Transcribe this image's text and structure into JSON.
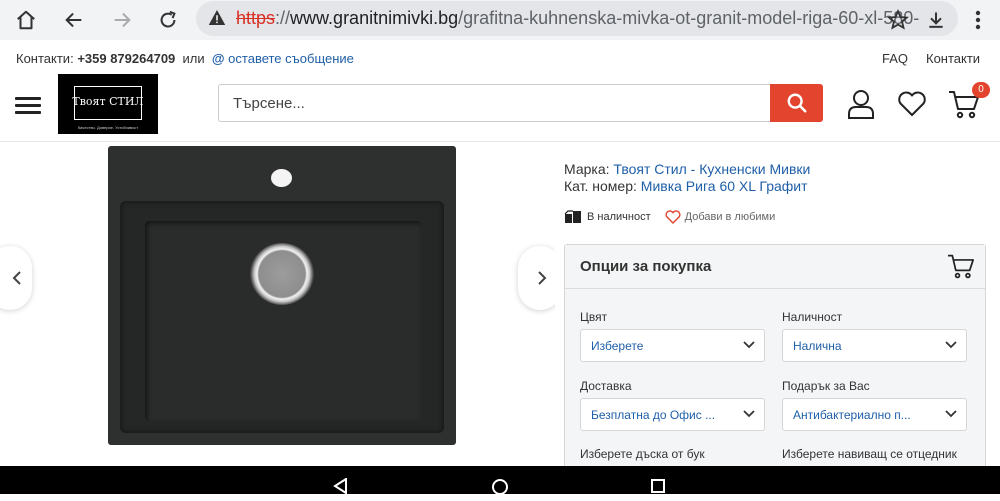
{
  "browser": {
    "url_scheme": "https",
    "url_sep": "://",
    "url_host": "www.granitnimivki.bg",
    "url_path": "/grafitna-kuhnenska-mivka-ot-granit-model-riga-60-xl-580-"
  },
  "topbar": {
    "contacts_label": "Контакти:",
    "phone": "+359 879264709",
    "or_text": "или",
    "at_symbol": "@",
    "message_link": "оставете съобщение",
    "faq": "FAQ",
    "contacts_link": "Контакти"
  },
  "header": {
    "logo_name": "Твоят СТИЛ",
    "logo_tagline": "Качество. Доверие. Устойчивост",
    "search_placeholder": "Търсене...",
    "cart_count": "0"
  },
  "product": {
    "brand_label": "Марка:",
    "brand_value": "Твоят Стил - Кухненски Мивки",
    "code_label": "Кат. номер:",
    "code_value": "Мивка Рига 60 XL Графит",
    "stock": "В наличност",
    "favorites": "Добави в любими"
  },
  "options": {
    "title": "Опции за покупка",
    "fields": [
      {
        "label": "Цвят",
        "value": "Изберете"
      },
      {
        "label": "Наличност",
        "value": "Налична"
      },
      {
        "label": "Доставка",
        "value": "Безплатна до Офис ..."
      },
      {
        "label": "Подарък за Вас",
        "value": "Антибактериално п..."
      },
      {
        "label": "Изберете дъска от бук",
        "value": ""
      },
      {
        "label": "Изберете навиващ се отцедник",
        "value": ""
      }
    ]
  },
  "colors": {
    "accent": "#e2442d",
    "link": "#1f5fa8",
    "panel_bg": "#f4f5f7"
  }
}
